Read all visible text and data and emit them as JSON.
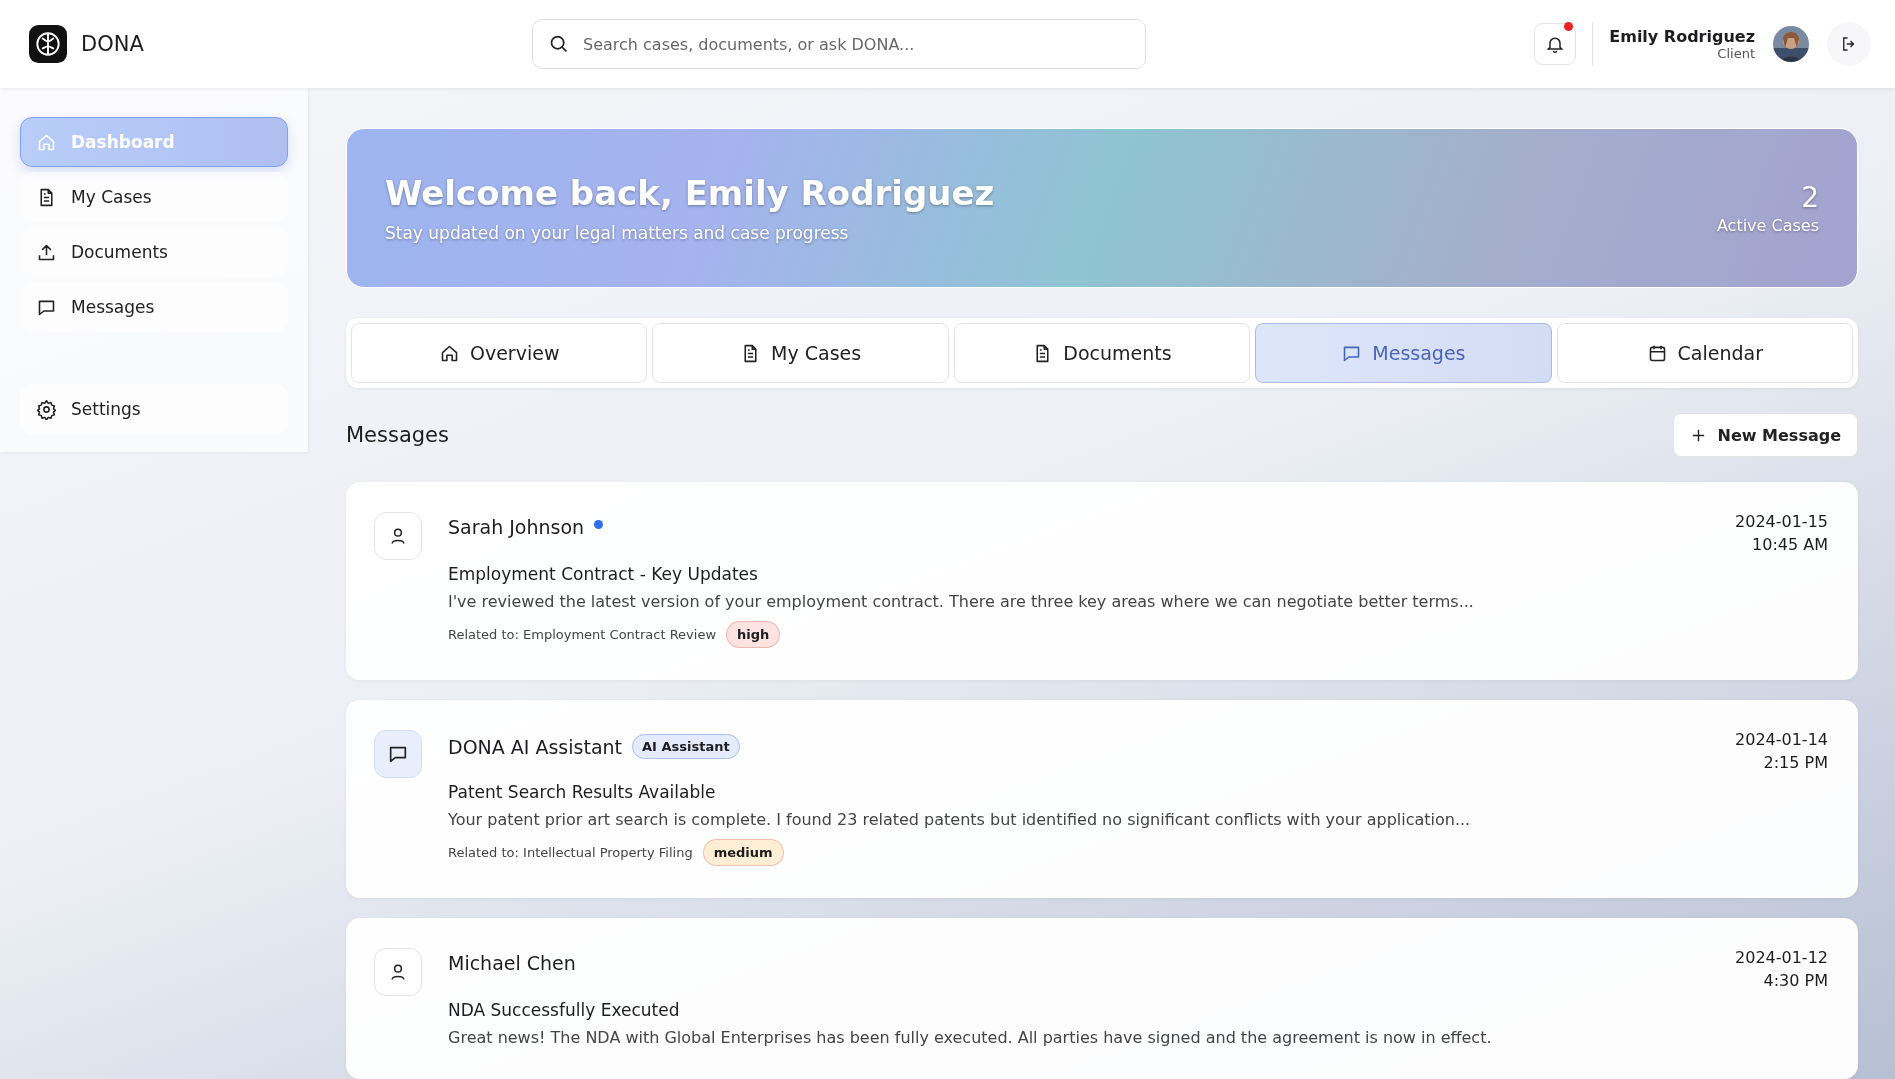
{
  "brand": {
    "name": "DONA"
  },
  "search": {
    "placeholder": "Search cases, documents, or ask DONA..."
  },
  "header": {
    "notifications_unread": true,
    "user_name": "Emily Rodriguez",
    "user_role": "Client"
  },
  "sidebar": {
    "items": [
      {
        "label": "Dashboard",
        "selected": true
      },
      {
        "label": "My Cases",
        "selected": false
      },
      {
        "label": "Documents",
        "selected": false
      },
      {
        "label": "Messages",
        "selected": false
      },
      {
        "label": "Settings",
        "selected": false
      }
    ]
  },
  "hero": {
    "title": "Welcome back, Emily Rodriguez",
    "subtitle": "Stay updated on your legal matters and case progress",
    "stat_value": "2",
    "stat_label": "Active Cases"
  },
  "tabs": [
    {
      "label": "Overview",
      "selected": false
    },
    {
      "label": "My Cases",
      "selected": false
    },
    {
      "label": "Documents",
      "selected": false
    },
    {
      "label": "Messages",
      "selected": true
    },
    {
      "label": "Calendar",
      "selected": false
    }
  ],
  "messages": {
    "title": "Messages",
    "new_button": "New Message",
    "items": [
      {
        "kind": "person",
        "sender": "Sarah Johnson",
        "unread": true,
        "date": "2024-01-15",
        "time": "10:45 AM",
        "subject": "Employment Contract - Key Updates",
        "preview": "I've reviewed the latest version of your employment contract. There are three key areas where we can negotiate better terms...",
        "related": "Related to: Employment Contract Review",
        "priority": "high",
        "color": "#fde2e2"
      },
      {
        "kind": "ai",
        "sender": "DONA AI Assistant",
        "badge": "AI Assistant",
        "unread": false,
        "date": "2024-01-14",
        "time": "2:15 PM",
        "subject": "Patent Search Results Available",
        "preview": "Your patent prior art search is complete. I found 23 related patents but identified no significant conflicts with your application...",
        "related": "Related to: Intellectual Property Filing",
        "priority": "medium",
        "color": "#fdefd6"
      },
      {
        "kind": "person",
        "sender": "Michael Chen",
        "unread": false,
        "date": "2024-01-12",
        "time": "4:30 PM",
        "subject": "NDA Successfully Executed",
        "preview": "Great news! The NDA with Global Enterprises has been fully executed. All parties have signed and the agreement is now in effect."
      }
    ]
  }
}
